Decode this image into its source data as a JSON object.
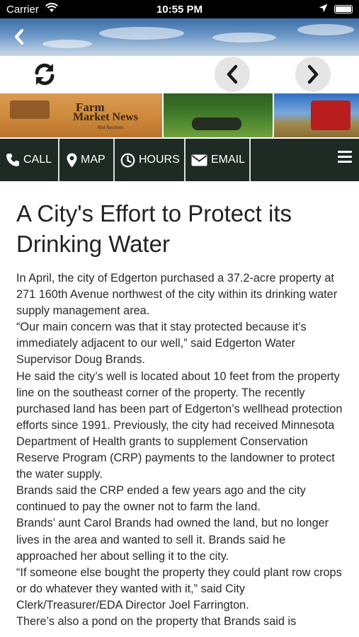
{
  "status_bar": {
    "carrier": "Carrier",
    "time": "10:55 PM"
  },
  "nav": {
    "call_label": "CALL",
    "map_label": "MAP",
    "hours_label": "HOURS",
    "email_label": "EMAIL"
  },
  "logo": {
    "line1": "Farm",
    "line2": "Market News",
    "line3": "And Auctions"
  },
  "article": {
    "title": "A City's Effort to Protect its Drinking Water",
    "paragraphs": [
      "In April, the city of Edgerton purchased a 37.2-acre property at 271 160th Avenue northwest of the city within its drinking water supply management area.",
      "“Our main concern was that it stay protected because it’s immediately adjacent to our well,” said Edgerton Water Supervisor Doug Brands.",
      "He said the city’s well is located about 10 feet from the property line on the southeast corner of the property. The recently purchased land has been part of Edgerton’s wellhead protection efforts since 1991. Previously, the city had received Minnesota Department of Health grants to supplement Conservation Reserve Program (CRP) payments to the landowner to protect the water supply.",
      "Brands said the CRP ended a few years ago and the city continued to pay the owner not to farm the land.",
      "Brands’ aunt Carol Brands had owned the land, but no longer lives in the area and wanted to sell it. Brands said he approached her about selling it to the city.",
      "“If someone else bought the property they could plant row crops or do whatever they wanted with it,” said City Clerk/Treasurer/EDA Director Joel Farrington.",
      "There’s also a pond on the property that Brands said is"
    ]
  },
  "colors": {
    "navbar_bg": "#1e2a24",
    "control_circle": "#e5e5e5"
  }
}
